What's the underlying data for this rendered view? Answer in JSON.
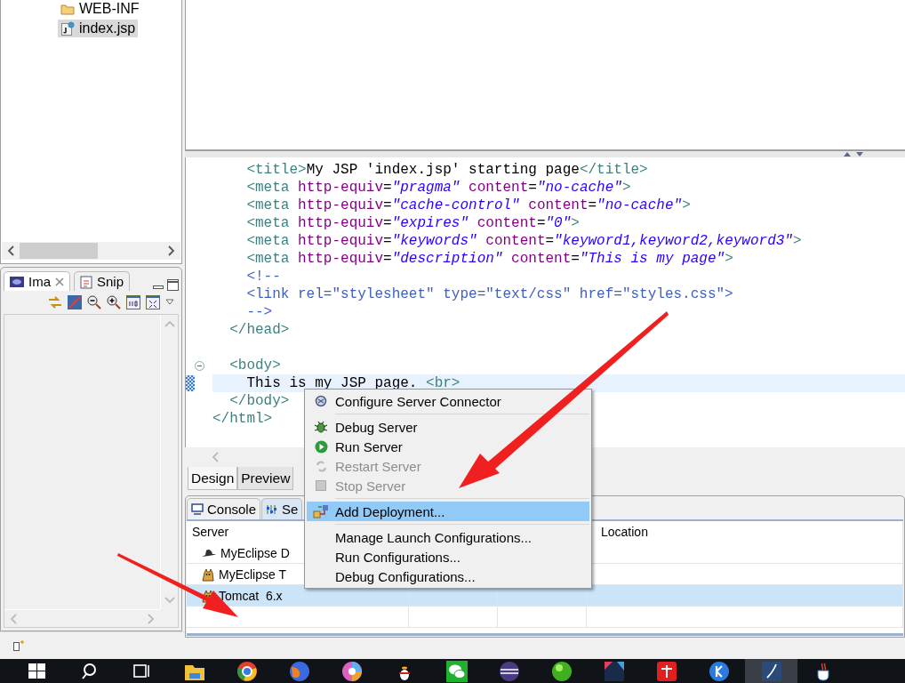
{
  "explorer": {
    "items": [
      {
        "label": "WEB-INF",
        "kind": "folder",
        "selected": false
      },
      {
        "label": "index.jsp",
        "kind": "file",
        "selected": true
      }
    ]
  },
  "image_panel": {
    "tabs": [
      {
        "label": "Ima",
        "selected": true,
        "closable": true
      },
      {
        "label": "Snip",
        "selected": false,
        "closable": false
      }
    ]
  },
  "editor": {
    "lines": [
      {
        "tokens": [
          {
            "kind": "tag",
            "text": "    <title>"
          },
          {
            "kind": "text",
            "text": "My JSP 'index.jsp' starting page"
          },
          {
            "kind": "tag",
            "text": "</title>"
          }
        ]
      },
      {
        "tokens": [
          {
            "kind": "tag",
            "text": "    <meta"
          },
          {
            "kind": "attr",
            "text": " http-equiv"
          },
          {
            "kind": "text",
            "text": "="
          },
          {
            "kind": "value",
            "text": "\"pragma\""
          },
          {
            "kind": "attr",
            "text": " content"
          },
          {
            "kind": "text",
            "text": "="
          },
          {
            "kind": "value",
            "text": "\"no-cache\""
          },
          {
            "kind": "tag",
            "text": ">"
          }
        ]
      },
      {
        "tokens": [
          {
            "kind": "tag",
            "text": "    <meta"
          },
          {
            "kind": "attr",
            "text": " http-equiv"
          },
          {
            "kind": "text",
            "text": "="
          },
          {
            "kind": "value",
            "text": "\"cache-control\""
          },
          {
            "kind": "attr",
            "text": " content"
          },
          {
            "kind": "text",
            "text": "="
          },
          {
            "kind": "value",
            "text": "\"no-cache\""
          },
          {
            "kind": "tag",
            "text": ">"
          }
        ]
      },
      {
        "tokens": [
          {
            "kind": "tag",
            "text": "    <meta"
          },
          {
            "kind": "attr",
            "text": " http-equiv"
          },
          {
            "kind": "text",
            "text": "="
          },
          {
            "kind": "value",
            "text": "\"expires\""
          },
          {
            "kind": "attr",
            "text": " content"
          },
          {
            "kind": "text",
            "text": "="
          },
          {
            "kind": "value",
            "text": "\"0\""
          },
          {
            "kind": "tag",
            "text": ">"
          }
        ]
      },
      {
        "tokens": [
          {
            "kind": "tag",
            "text": "    <meta"
          },
          {
            "kind": "attr",
            "text": " http-equiv"
          },
          {
            "kind": "text",
            "text": "="
          },
          {
            "kind": "value",
            "text": "\"keywords\""
          },
          {
            "kind": "attr",
            "text": " content"
          },
          {
            "kind": "text",
            "text": "="
          },
          {
            "kind": "value",
            "text": "\"keyword1,keyword2,keyword3\""
          },
          {
            "kind": "tag",
            "text": ">"
          }
        ]
      },
      {
        "tokens": [
          {
            "kind": "tag",
            "text": "    <meta"
          },
          {
            "kind": "attr",
            "text": " http-equiv"
          },
          {
            "kind": "text",
            "text": "="
          },
          {
            "kind": "value",
            "text": "\"description\""
          },
          {
            "kind": "attr",
            "text": " content"
          },
          {
            "kind": "text",
            "text": "="
          },
          {
            "kind": "value",
            "text": "\"This is my page\""
          },
          {
            "kind": "tag",
            "text": ">"
          }
        ]
      },
      {
        "tokens": [
          {
            "kind": "comment",
            "text": "    <!--"
          }
        ]
      },
      {
        "tokens": [
          {
            "kind": "comment",
            "text": "    <link rel=\"stylesheet\" type=\"text/css\" href=\"styles.css\">"
          }
        ]
      },
      {
        "tokens": [
          {
            "kind": "comment",
            "text": "    -->"
          }
        ]
      },
      {
        "tokens": [
          {
            "kind": "tag",
            "text": "  </head>"
          }
        ]
      },
      {
        "expanded": true,
        "tokens": [
          {
            "kind": "tag",
            "text": "  <body>"
          }
        ]
      },
      {
        "current": true,
        "tokens": [
          {
            "kind": "text",
            "text": "    This is my JSP page. "
          },
          {
            "kind": "tag",
            "text": "<br>"
          }
        ]
      },
      {
        "tokens": [
          {
            "kind": "tag",
            "text": "  </body>"
          }
        ]
      },
      {
        "tokens": [
          {
            "kind": "tag",
            "text": "</html>"
          }
        ]
      }
    ],
    "mode_tabs": [
      {
        "label": "Design",
        "selected": true
      },
      {
        "label": "Preview",
        "selected": false
      }
    ]
  },
  "bottom_panel": {
    "tabs": [
      {
        "label": "Console",
        "selected": false
      },
      {
        "label": "Se",
        "selected": true
      }
    ],
    "table": {
      "server_heading": "Server",
      "location_heading": "Location",
      "rows": [
        {
          "server": "MyEclipse D",
          "selected": false
        },
        {
          "server": "MyEclipse T",
          "selected": false
        },
        {
          "server": "Tomcat  6.x",
          "selected": true
        }
      ]
    }
  },
  "context_menu": {
    "items": [
      {
        "kind": "item",
        "label": "Configure Server Connector",
        "disabled": false,
        "selected": false
      },
      {
        "kind": "separator"
      },
      {
        "kind": "item",
        "label": "Debug Server",
        "disabled": false,
        "selected": false
      },
      {
        "kind": "item",
        "label": "Run Server",
        "disabled": false,
        "selected": false
      },
      {
        "kind": "item",
        "label": "Restart Server",
        "disabled": true,
        "selected": false
      },
      {
        "kind": "item",
        "label": "Stop Server",
        "disabled": true,
        "selected": false
      },
      {
        "kind": "separator"
      },
      {
        "kind": "item",
        "label": "Add Deployment...",
        "disabled": false,
        "selected": true
      },
      {
        "kind": "separator"
      },
      {
        "kind": "item",
        "label": "Manage Launch Configurations...",
        "disabled": false,
        "selected": false
      },
      {
        "kind": "item",
        "label": "Run Configurations...",
        "disabled": false,
        "selected": false
      },
      {
        "kind": "item",
        "label": "Debug Configurations...",
        "disabled": false,
        "selected": false
      }
    ]
  },
  "taskbar": {
    "apps": [
      {
        "selected": false
      },
      {
        "selected": false
      },
      {
        "selected": false
      },
      {
        "selected": false
      },
      {
        "selected": false
      },
      {
        "selected": false
      },
      {
        "selected": false
      },
      {
        "selected": false
      },
      {
        "selected": false
      },
      {
        "selected": false
      },
      {
        "selected": false
      },
      {
        "selected": true
      },
      {
        "selected": false
      }
    ]
  }
}
